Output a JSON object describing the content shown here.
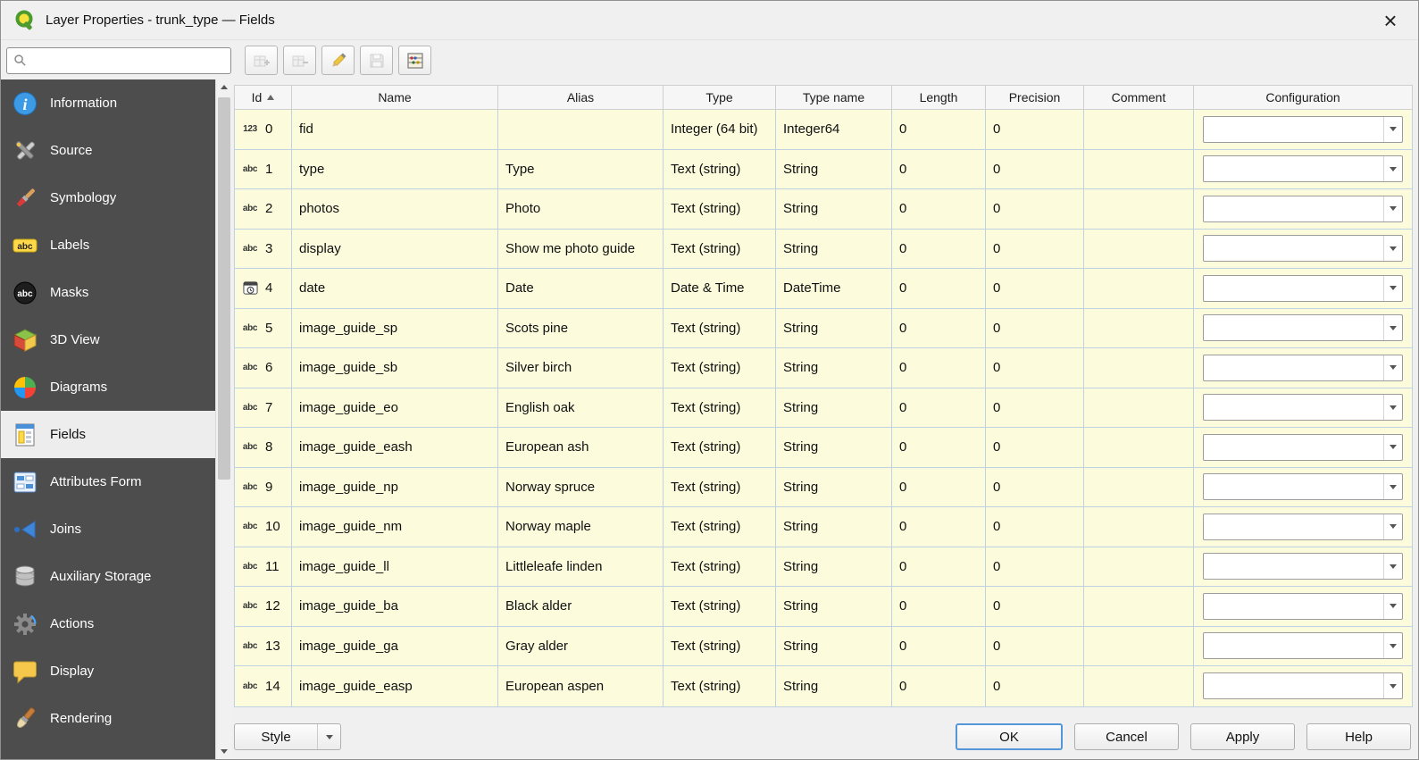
{
  "window": {
    "title": "Layer Properties - trunk_type — Fields",
    "close_glyph": "×"
  },
  "search": {
    "value": "",
    "placeholder": ""
  },
  "toolbar": {
    "buttons": [
      {
        "id": "new-field",
        "icon": "new-field",
        "enabled": false
      },
      {
        "id": "delete-field",
        "icon": "delete-field",
        "enabled": false
      },
      {
        "id": "toggle-editing",
        "icon": "pencil",
        "enabled": true
      },
      {
        "id": "save-edits",
        "icon": "save",
        "enabled": false
      },
      {
        "id": "field-calculator",
        "icon": "calculator",
        "enabled": true
      }
    ]
  },
  "sidebar": {
    "items": [
      {
        "label": "Information",
        "icon": "info",
        "selected": false
      },
      {
        "label": "Source",
        "icon": "source",
        "selected": false
      },
      {
        "label": "Symbology",
        "icon": "symbology",
        "selected": false
      },
      {
        "label": "Labels",
        "icon": "labels",
        "selected": false
      },
      {
        "label": "Masks",
        "icon": "masks",
        "selected": false
      },
      {
        "label": "3D View",
        "icon": "view3d",
        "selected": false
      },
      {
        "label": "Diagrams",
        "icon": "diagrams",
        "selected": false
      },
      {
        "label": "Fields",
        "icon": "fields",
        "selected": true
      },
      {
        "label": "Attributes Form",
        "icon": "attributes-form",
        "selected": false
      },
      {
        "label": "Joins",
        "icon": "joins",
        "selected": false
      },
      {
        "label": "Auxiliary Storage",
        "icon": "auxiliary-storage",
        "selected": false
      },
      {
        "label": "Actions",
        "icon": "actions",
        "selected": false
      },
      {
        "label": "Display",
        "icon": "display",
        "selected": false
      },
      {
        "label": "Rendering",
        "icon": "rendering",
        "selected": false
      }
    ]
  },
  "table": {
    "columns": [
      {
        "key": "id",
        "label": "Id",
        "sort": "asc"
      },
      {
        "key": "name",
        "label": "Name"
      },
      {
        "key": "alias",
        "label": "Alias"
      },
      {
        "key": "type",
        "label": "Type"
      },
      {
        "key": "type_name",
        "label": "Type name"
      },
      {
        "key": "length",
        "label": "Length"
      },
      {
        "key": "precision",
        "label": "Precision"
      },
      {
        "key": "comment",
        "label": "Comment"
      },
      {
        "key": "configuration",
        "label": "Configuration"
      }
    ],
    "rows": [
      {
        "id": "0",
        "data_type": "integer",
        "name": "fid",
        "alias": "",
        "type": "Integer (64 bit)",
        "type_name": "Integer64",
        "length": "0",
        "precision": "0",
        "comment": "",
        "configuration": ""
      },
      {
        "id": "1",
        "data_type": "string",
        "name": "type",
        "alias": "Type",
        "type": "Text (string)",
        "type_name": "String",
        "length": "0",
        "precision": "0",
        "comment": "",
        "configuration": ""
      },
      {
        "id": "2",
        "data_type": "string",
        "name": "photos",
        "alias": "Photo",
        "type": "Text (string)",
        "type_name": "String",
        "length": "0",
        "precision": "0",
        "comment": "",
        "configuration": ""
      },
      {
        "id": "3",
        "data_type": "string",
        "name": "display",
        "alias": "Show me photo guide",
        "type": "Text (string)",
        "type_name": "String",
        "length": "0",
        "precision": "0",
        "comment": "",
        "configuration": ""
      },
      {
        "id": "4",
        "data_type": "datetime",
        "name": "date",
        "alias": "Date",
        "type": "Date & Time",
        "type_name": "DateTime",
        "length": "0",
        "precision": "0",
        "comment": "",
        "configuration": ""
      },
      {
        "id": "5",
        "data_type": "string",
        "name": "image_guide_sp",
        "alias": "Scots pine",
        "type": "Text (string)",
        "type_name": "String",
        "length": "0",
        "precision": "0",
        "comment": "",
        "configuration": ""
      },
      {
        "id": "6",
        "data_type": "string",
        "name": "image_guide_sb",
        "alias": "Silver birch",
        "type": "Text (string)",
        "type_name": "String",
        "length": "0",
        "precision": "0",
        "comment": "",
        "configuration": ""
      },
      {
        "id": "7",
        "data_type": "string",
        "name": "image_guide_eo",
        "alias": "English oak",
        "type": "Text (string)",
        "type_name": "String",
        "length": "0",
        "precision": "0",
        "comment": "",
        "configuration": ""
      },
      {
        "id": "8",
        "data_type": "string",
        "name": "image_guide_eash",
        "alias": "European ash",
        "type": "Text (string)",
        "type_name": "String",
        "length": "0",
        "precision": "0",
        "comment": "",
        "configuration": ""
      },
      {
        "id": "9",
        "data_type": "string",
        "name": "image_guide_np",
        "alias": "Norway spruce",
        "type": "Text (string)",
        "type_name": "String",
        "length": "0",
        "precision": "0",
        "comment": "",
        "configuration": ""
      },
      {
        "id": "10",
        "data_type": "string",
        "name": "image_guide_nm",
        "alias": "Norway maple",
        "type": "Text (string)",
        "type_name": "String",
        "length": "0",
        "precision": "0",
        "comment": "",
        "configuration": ""
      },
      {
        "id": "11",
        "data_type": "string",
        "name": "image_guide_ll",
        "alias": "Littleleafe linden",
        "type": "Text (string)",
        "type_name": "String",
        "length": "0",
        "precision": "0",
        "comment": "",
        "configuration": ""
      },
      {
        "id": "12",
        "data_type": "string",
        "name": "image_guide_ba",
        "alias": "Black alder",
        "type": "Text (string)",
        "type_name": "String",
        "length": "0",
        "precision": "0",
        "comment": "",
        "configuration": ""
      },
      {
        "id": "13",
        "data_type": "string",
        "name": "image_guide_ga",
        "alias": "Gray alder",
        "type": "Text (string)",
        "type_name": "String",
        "length": "0",
        "precision": "0",
        "comment": "",
        "configuration": ""
      },
      {
        "id": "14",
        "data_type": "string",
        "name": "image_guide_easp",
        "alias": "European aspen",
        "type": "Text (string)",
        "type_name": "String",
        "length": "0",
        "precision": "0",
        "comment": "",
        "configuration": ""
      }
    ]
  },
  "footer": {
    "style_label": "Style",
    "buttons": [
      {
        "label": "OK",
        "primary": true
      },
      {
        "label": "Cancel",
        "primary": false
      },
      {
        "label": "Apply",
        "primary": false
      },
      {
        "label": "Help",
        "primary": false
      }
    ]
  },
  "colors": {
    "row_background": "#fcfcdd",
    "grid_line": "#bed2e4",
    "sidebar_background": "#4d4d4d",
    "accent": "#5596d8"
  }
}
